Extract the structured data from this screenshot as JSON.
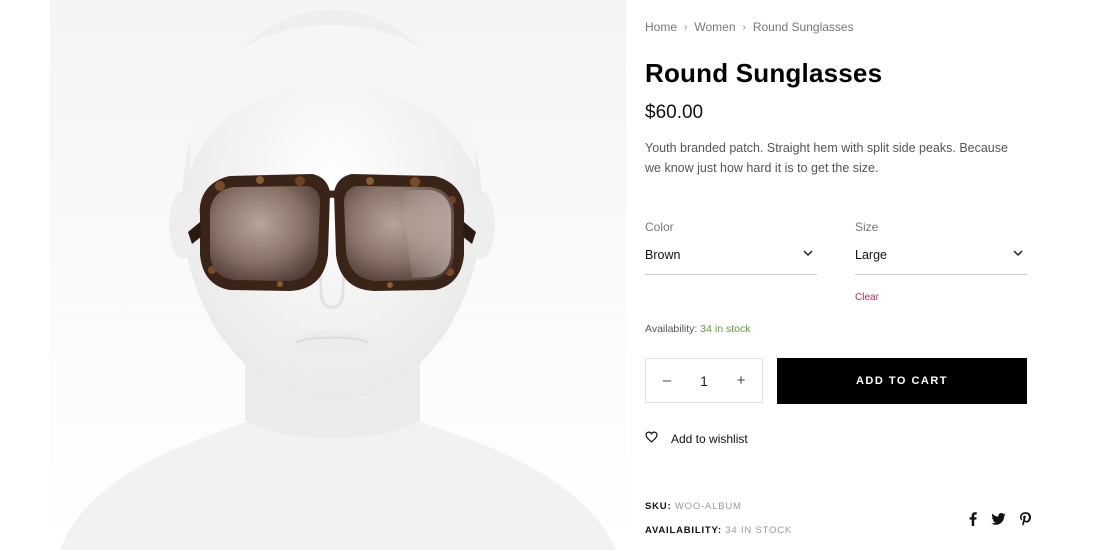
{
  "breadcrumb": {
    "items": [
      "Home",
      "Women",
      "Round Sunglasses"
    ],
    "separator": "›"
  },
  "product": {
    "title": "Round Sunglasses",
    "price": "$60.00",
    "description": "Youth branded patch. Straight hem with split side peaks. Because we know just how hard it is to get the size."
  },
  "variations": {
    "color": {
      "label": "Color",
      "selected": "Brown"
    },
    "size": {
      "label": "Size",
      "selected": "Large"
    },
    "clear_label": "Clear"
  },
  "availability": {
    "label": "Availability:",
    "value": "34 in stock"
  },
  "quantity": {
    "decrement": "–",
    "value": "1",
    "increment": "+"
  },
  "cart": {
    "add_label": "ADD TO CART"
  },
  "wishlist": {
    "label": "Add to wishlist",
    "icon": "heart-icon"
  },
  "meta": {
    "sku_label": "SKU:",
    "sku_value": "WOO-ALBUM",
    "availability_label": "AVAILABILITY:",
    "availability_value": "34 IN STOCK"
  },
  "share": {
    "icons": [
      "facebook-icon",
      "twitter-icon",
      "pinterest-icon"
    ]
  },
  "colors": {
    "accent_clear": "#c0285a",
    "in_stock": "#5c9a3c",
    "button_bg": "#000000"
  }
}
